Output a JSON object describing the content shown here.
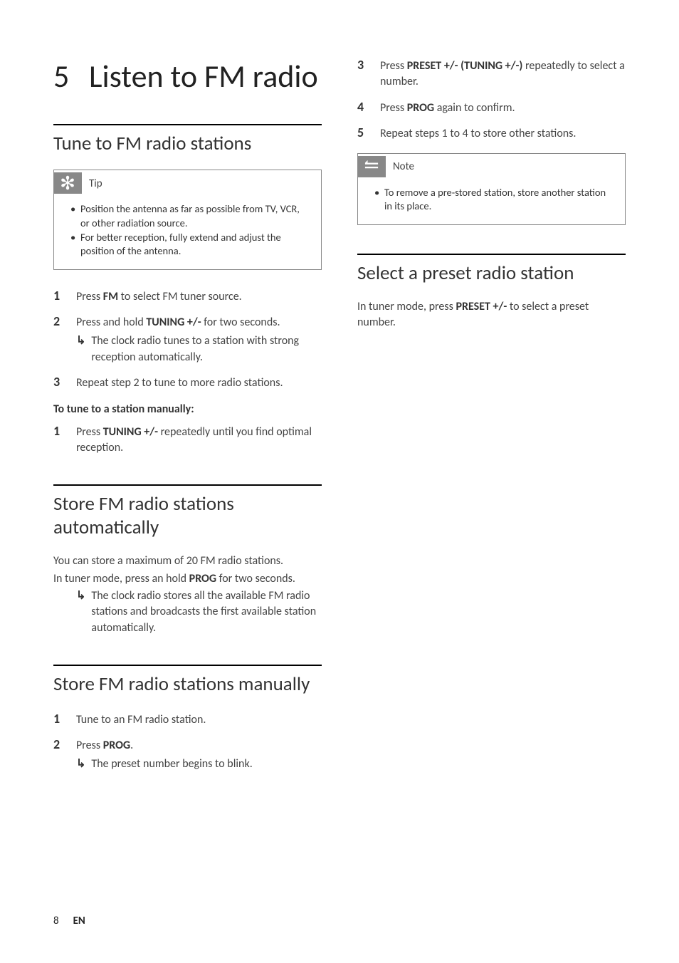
{
  "chapter": {
    "number": "5",
    "title": "Listen to FM radio"
  },
  "col1": {
    "section1": {
      "title": "Tune to FM radio stations",
      "tip": {
        "label": "Tip",
        "items": [
          "Position the antenna as far as possible from TV, VCR, or other radiation source.",
          "For better reception, fully extend and adjust the position of the antenna."
        ]
      },
      "steps": [
        {
          "num": "1",
          "text_pre": "Press ",
          "bold": "FM",
          "text_post": " to select FM tuner source."
        },
        {
          "num": "2",
          "text_pre": "Press and hold ",
          "bold": "TUNING +/-",
          "text_post": " for two seconds.",
          "result": "The clock radio tunes to a station with strong reception automatically."
        },
        {
          "num": "3",
          "text_pre": "Repeat step 2 to tune to more radio stations.",
          "bold": "",
          "text_post": ""
        }
      ],
      "subheading": "To tune to a station manually:",
      "manual_steps": [
        {
          "num": "1",
          "text_pre": "Press ",
          "bold": "TUNING +/-",
          "text_post": " repeatedly until you find optimal reception."
        }
      ]
    },
    "section2": {
      "title": "Store FM radio stations automatically",
      "body1": "You can store a maximum of 20 FM radio stations.",
      "body2_pre": "In tuner mode, press an hold ",
      "body2_bold": "PROG",
      "body2_post": " for two seconds.",
      "result": "The clock radio stores all the available FM radio stations and broadcasts the first available station automatically."
    },
    "section3": {
      "title": "Store FM radio stations manually",
      "steps": [
        {
          "num": "1",
          "text_pre": "Tune to an FM radio station.",
          "bold": "",
          "text_post": ""
        },
        {
          "num": "2",
          "text_pre": "Press ",
          "bold": "PROG",
          "text_post": ".",
          "result": "The preset number begins to blink."
        }
      ]
    }
  },
  "col2": {
    "cont_steps": [
      {
        "num": "3",
        "text_pre": "Press ",
        "bold": "PRESET +/- (TUNING +/-)",
        "text_post": " repeatedly to select a number."
      },
      {
        "num": "4",
        "text_pre": "Press ",
        "bold": "PROG",
        "text_post": " again to confirm."
      },
      {
        "num": "5",
        "text_pre": "Repeat steps 1 to 4 to store other stations.",
        "bold": "",
        "text_post": ""
      }
    ],
    "note": {
      "label": "Note",
      "items": [
        "To remove a pre-stored station, store another station in its place."
      ]
    },
    "section4": {
      "title": "Select a preset radio station",
      "body_pre": "In tuner mode, press ",
      "body_bold": "PRESET +/-",
      "body_post": " to select a preset number."
    }
  },
  "footer": {
    "page": "8",
    "lang": "EN"
  }
}
